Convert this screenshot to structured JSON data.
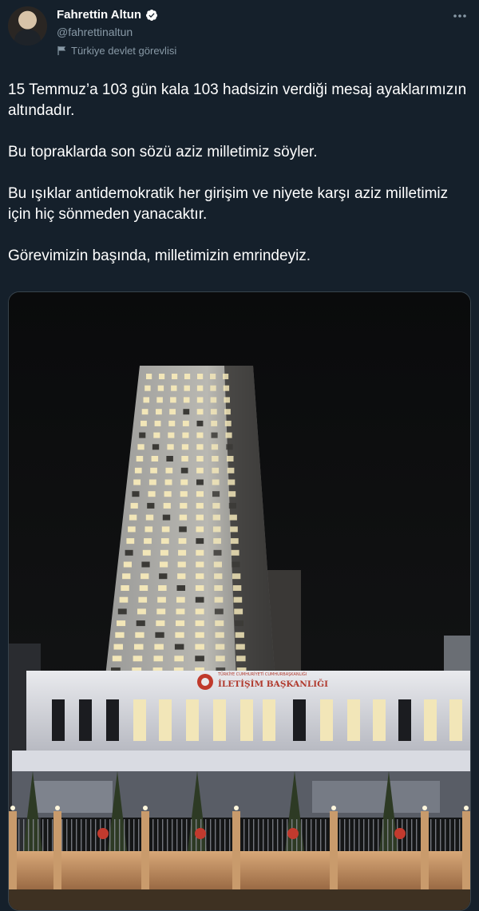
{
  "header": {
    "display_name": "Fahrettin Altun",
    "handle": "@fahrettinaltun",
    "account_label": "Türkiye devlet görevlisi",
    "verified": true,
    "verified_color": "#ffffff",
    "more_menu_icon": "more-dots-icon"
  },
  "tweet": {
    "paragraphs": [
      "15 Temmuz’a 103 gün kala 103 hadsizin verdiği mesaj ayaklarımızın altındadır.",
      "Bu topraklarda son sözü aziz milletimiz söyler.",
      "Bu ışıklar antidemokratik her girişim ve niyete karşı aziz milletimiz için hiç sönmeden yanacaktır.",
      "Görevimizin başında, milletimizin emrindeyiz."
    ]
  },
  "media": {
    "building_sign_lines": [
      "TÜRKİYE CUMHURİYETİ CUMHURBAŞKANLIĞI",
      "İLETİŞİM BAŞKANLIĞI"
    ],
    "window_color": "#f2e6b8"
  },
  "colors": {
    "background": "#15202b",
    "secondary_text": "#8899a6",
    "border": "#38444d"
  }
}
